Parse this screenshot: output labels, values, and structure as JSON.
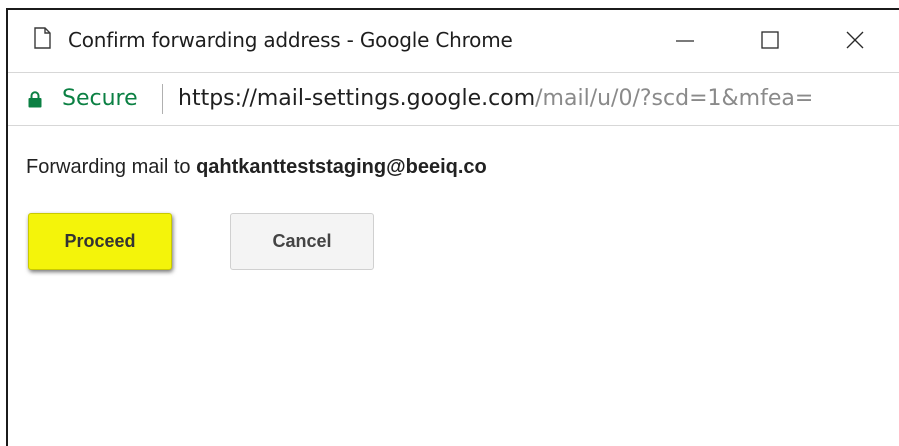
{
  "window": {
    "title": "Confirm forwarding address - Google Chrome",
    "controls": {
      "minimize_icon": "minimize-icon",
      "maximize_icon": "maximize-icon",
      "close_icon": "close-icon"
    }
  },
  "addressbar": {
    "secure_label": "Secure",
    "url_host": "https://mail-settings.google.com",
    "url_rest": "/mail/u/0/?scd=1&mfea="
  },
  "dialog": {
    "message_prefix": "Forwarding mail to",
    "email": "qahtkantteststaging@beeiq.co",
    "proceed_label": "Proceed",
    "cancel_label": "Cancel"
  },
  "colors": {
    "secure_green": "#0b8043",
    "proceed_yellow": "#f4f40a",
    "cancel_gray": "#f4f4f4"
  }
}
